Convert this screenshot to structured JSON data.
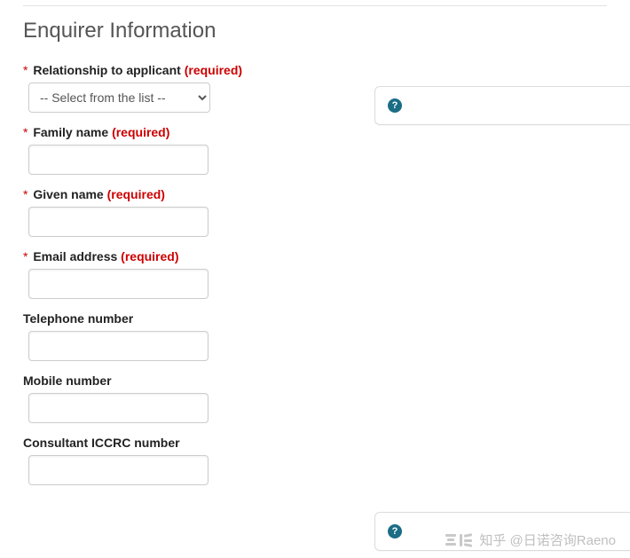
{
  "section": {
    "title": "Enquirer Information"
  },
  "labels": {
    "required_marker": "*",
    "required_text": "(required)"
  },
  "fields": {
    "relationship": {
      "label": "Relationship to applicant",
      "required": true,
      "selected_option": "-- Select from the list --"
    },
    "family_name": {
      "label": "Family name",
      "required": true,
      "value": ""
    },
    "given_name": {
      "label": "Given name",
      "required": true,
      "value": ""
    },
    "email": {
      "label": "Email address",
      "required": true,
      "value": ""
    },
    "telephone": {
      "label": "Telephone number",
      "required": false,
      "value": ""
    },
    "mobile": {
      "label": "Mobile number",
      "required": false,
      "value": ""
    },
    "iccrc": {
      "label": "Consultant ICCRC number",
      "required": false,
      "value": ""
    }
  },
  "help_icon_glyph": "?",
  "watermark": {
    "text": "知乎 @日诺咨询Raeno"
  }
}
